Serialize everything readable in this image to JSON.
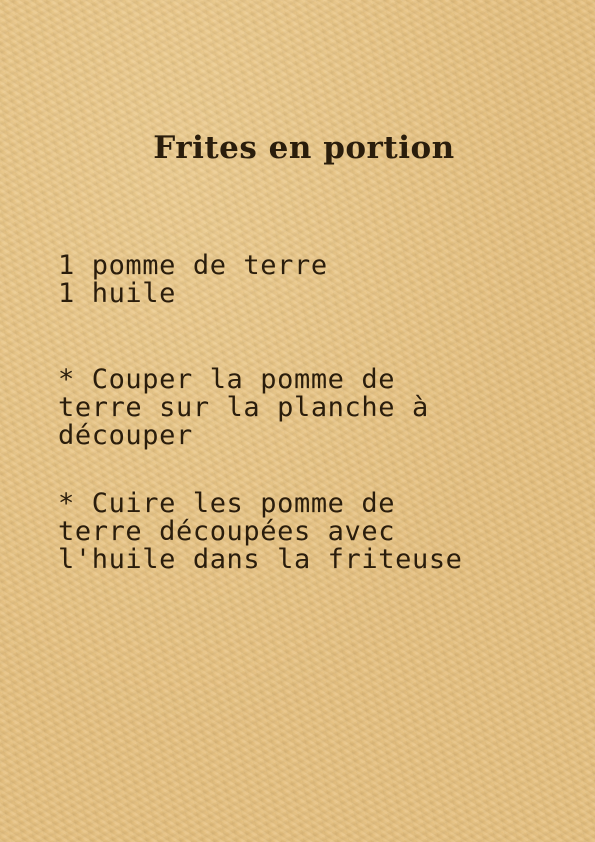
{
  "recipe": {
    "title": "Frites en portion",
    "ingredients": [
      "1 pomme de terre",
      "1 huile"
    ],
    "steps": [
      {
        "lines": [
          "* Couper la pomme de",
          "terre sur la planche à",
          "découper"
        ]
      },
      {
        "lines": [
          "* Cuire les pomme de",
          "terre découpées avec",
          "l'huile dans la friteuse"
        ]
      }
    ]
  },
  "colors": {
    "paper": "#e6c07e",
    "ink": "#2a1d0c"
  }
}
